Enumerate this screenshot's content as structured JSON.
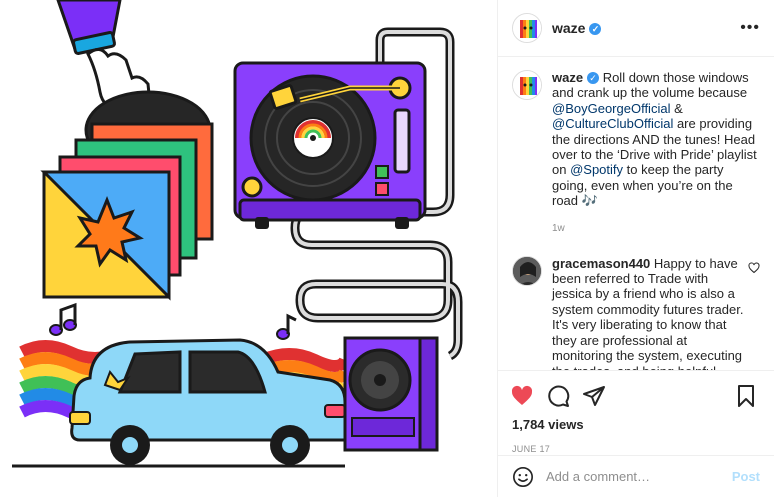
{
  "post": {
    "username": "waze",
    "verified_mark": "✓",
    "more_glyph": "•••"
  },
  "caption": {
    "username": "waze",
    "text_1": " Roll down those windows and crank up the volume because ",
    "mention_1": "@BoyGeorgeOfficial",
    "text_2": " & ",
    "mention_2": "@CultureClubOfficial",
    "text_3": " are providing the directions AND the tunes! Head over to the ‘Drive with Pride’ playlist on ",
    "mention_3": "@Spotify",
    "text_4": " to keep the party going, even when you’re on the road 🎶",
    "time": "1w"
  },
  "comment": {
    "username": "gracemason440",
    "text": " Happy to have been referred to Trade with jessica by a friend who is also a system commodity futures trader. It's very liberating to know that they are professional at monitoring the system, executing the trades, and being helpful whenever I ask for additional info or assistance. If you"
  },
  "stats": {
    "views": "1,784 views",
    "date": "JUNE 17"
  },
  "add_comment": {
    "placeholder": "Add a comment…",
    "post_label": "Post"
  },
  "icons": {
    "like": "heart-icon",
    "comment": "comment-icon",
    "share": "share-icon",
    "save": "bookmark-icon",
    "emoji": "emoji-icon"
  },
  "colors": {
    "like_red": "#ed4956",
    "link": "#00376b",
    "post_disabled": "#b2dffc",
    "waze_purple": "#7b2ff7"
  }
}
